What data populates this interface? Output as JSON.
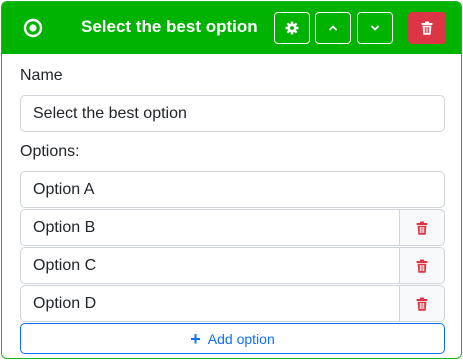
{
  "question": {
    "title": "Select the best option",
    "type_icon": "radio-icon",
    "header_actions": {
      "settings_icon": "gear-icon",
      "move_up_icon": "chevron-up-icon",
      "move_down_icon": "chevron-down-icon",
      "delete_icon": "trash-icon"
    }
  },
  "form": {
    "name_label": "Name",
    "name_value": "Select the best option",
    "options_label": "Options:",
    "options": [
      {
        "value": "Option A"
      },
      {
        "value": "Option B",
        "remove_icon": "trash-icon"
      },
      {
        "value": "Option C",
        "remove_icon": "trash-icon"
      },
      {
        "value": "Option D",
        "remove_icon": "trash-icon"
      }
    ],
    "add_option": {
      "icon": "plus-icon",
      "label": "Add option"
    }
  },
  "colors": {
    "header": "#00b300",
    "danger": "#dc3545",
    "primary": "#0d6efd"
  }
}
